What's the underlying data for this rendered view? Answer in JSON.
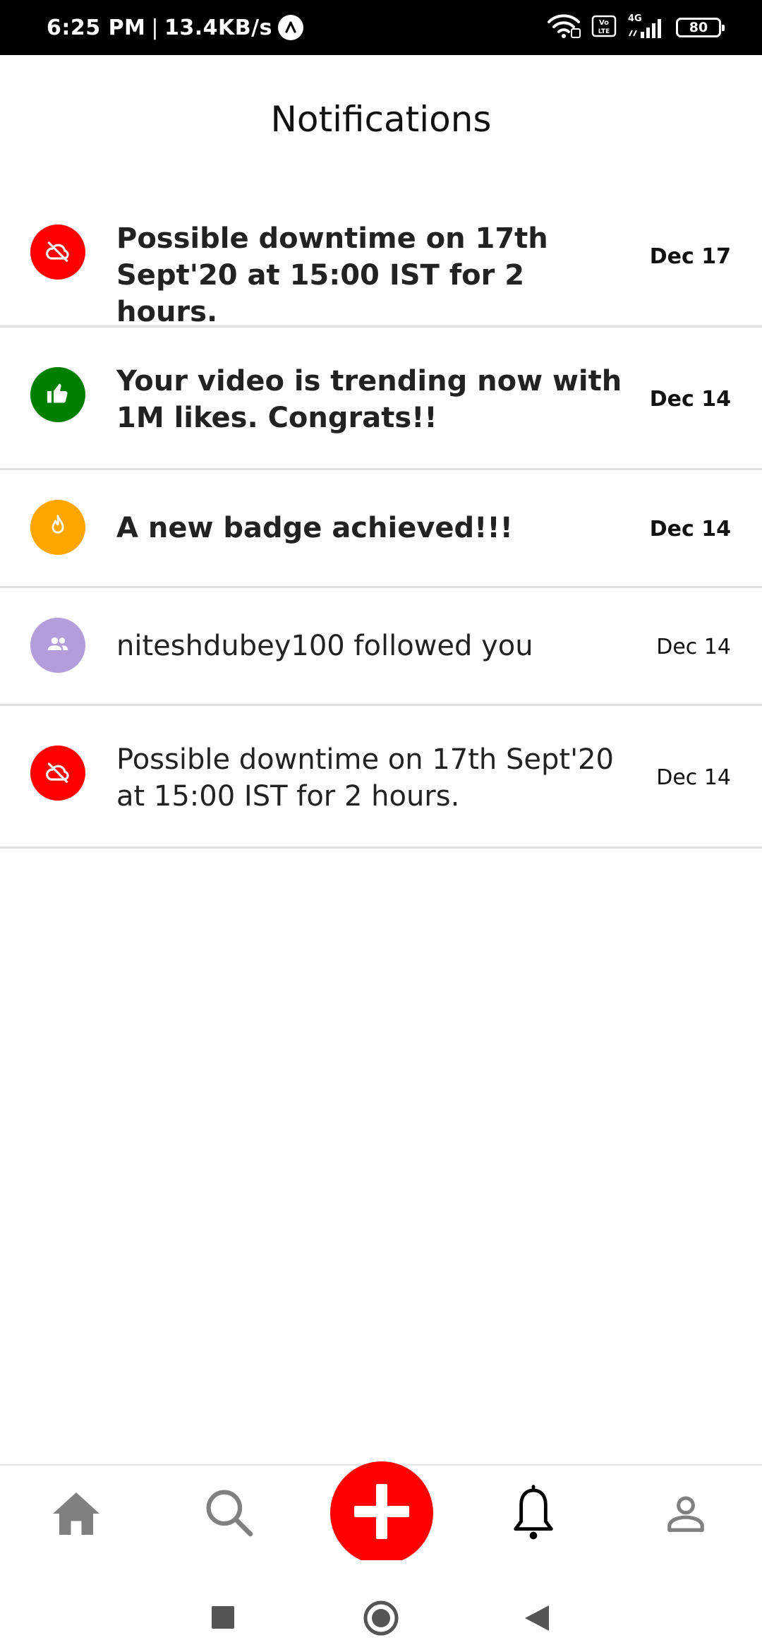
{
  "status_bar": {
    "time": "6:25 PM",
    "separator": "|",
    "speed": "13.4KB/s",
    "network_label": "4G",
    "battery_level": "80",
    "icons": [
      "app-a-icon",
      "wifi-icon",
      "volte-icon",
      "signal-icon",
      "battery-icon"
    ]
  },
  "header": {
    "title": "Notifications"
  },
  "notifications": [
    {
      "message": "Possible downtime on 17th Sept'20 at 15:00 IST for 2 hours.",
      "date": "Dec 17",
      "icon": "cloud-off-icon",
      "color": "#ff0000",
      "unread": true
    },
    {
      "message": "Your video is trending now with 1M likes. Congrats!!",
      "date": "Dec 14",
      "icon": "thumb-up-icon",
      "color": "#008000",
      "unread": true
    },
    {
      "message": "A new badge achieved!!!",
      "date": "Dec 14",
      "icon": "flame-icon",
      "color": "#ffa500",
      "unread": true
    },
    {
      "message": "niteshdubey100 followed you",
      "date": "Dec 14",
      "icon": "people-icon",
      "color": "#b39ddb",
      "unread": false
    },
    {
      "message": "Possible downtime on 17th Sept'20 at 15:00 IST for 2 hours.",
      "date": "Dec 14",
      "icon": "cloud-off-icon",
      "color": "#ff0000",
      "unread": false
    }
  ],
  "bottom_nav": {
    "items": [
      {
        "icon": "home-icon",
        "active": false
      },
      {
        "icon": "search-icon",
        "active": false
      },
      {
        "icon": "add-icon",
        "active": false
      },
      {
        "icon": "bell-icon",
        "active": true
      },
      {
        "icon": "profile-icon",
        "active": false
      }
    ],
    "active_color": "#000000",
    "inactive_color": "#808080",
    "add_color": "#ff0000"
  },
  "system_nav": {
    "icons": [
      "recents-square-icon",
      "home-circle-icon",
      "back-triangle-icon"
    ]
  }
}
